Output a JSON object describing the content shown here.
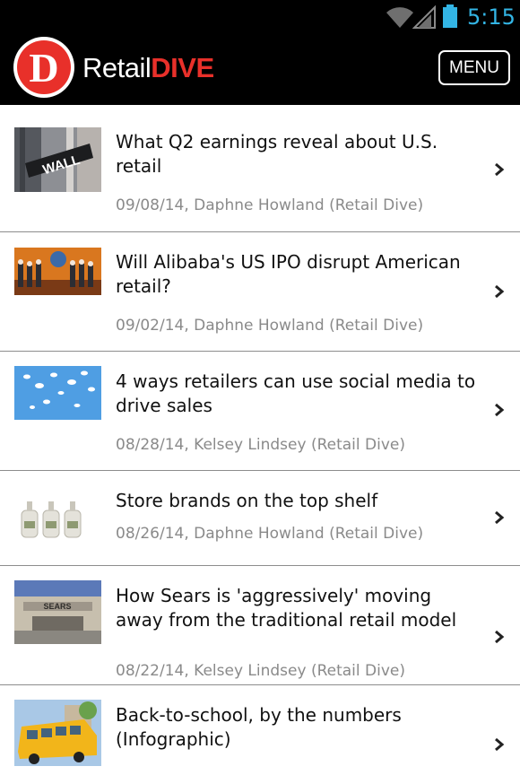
{
  "status_bar": {
    "time": "5:15",
    "wifi_icon": "wifi-icon",
    "signal_icon": "cell-signal-icon",
    "battery_icon": "battery-icon"
  },
  "header": {
    "logo_letter": "D",
    "brand_retail": "Retail",
    "brand_dive": "DIVE",
    "menu_label": "MENU",
    "colors": {
      "brand_red": "#e8302a",
      "status_blue": "#33b5e5"
    }
  },
  "articles": [
    {
      "title": "What Q2 earnings reveal about U.S. retail",
      "meta": "09/08/14, Daphne Howland (Retail Dive)",
      "thumb": "wall-street-sign"
    },
    {
      "title": "Will Alibaba's US IPO disrupt American retail?",
      "meta": "09/02/14, Daphne Howland (Retail Dive)",
      "thumb": "alibaba-ipo-stage"
    },
    {
      "title": "4 ways retailers can use social media to drive sales",
      "meta": "08/28/14, Kelsey Lindsey (Retail Dive)",
      "thumb": "social-birds-sky"
    },
    {
      "title": "Store brands on the top shelf",
      "meta": "08/26/14, Daphne Howland (Retail Dive)",
      "thumb": "store-brand-bottles"
    },
    {
      "title": "How Sears is 'aggressively' moving away from the traditional retail model",
      "meta": "08/22/14, Kelsey Lindsey (Retail Dive)",
      "thumb": "sears-storefront"
    },
    {
      "title": "Back-to-school, by the numbers (Infographic)",
      "meta": "",
      "thumb": "school-bus"
    }
  ]
}
